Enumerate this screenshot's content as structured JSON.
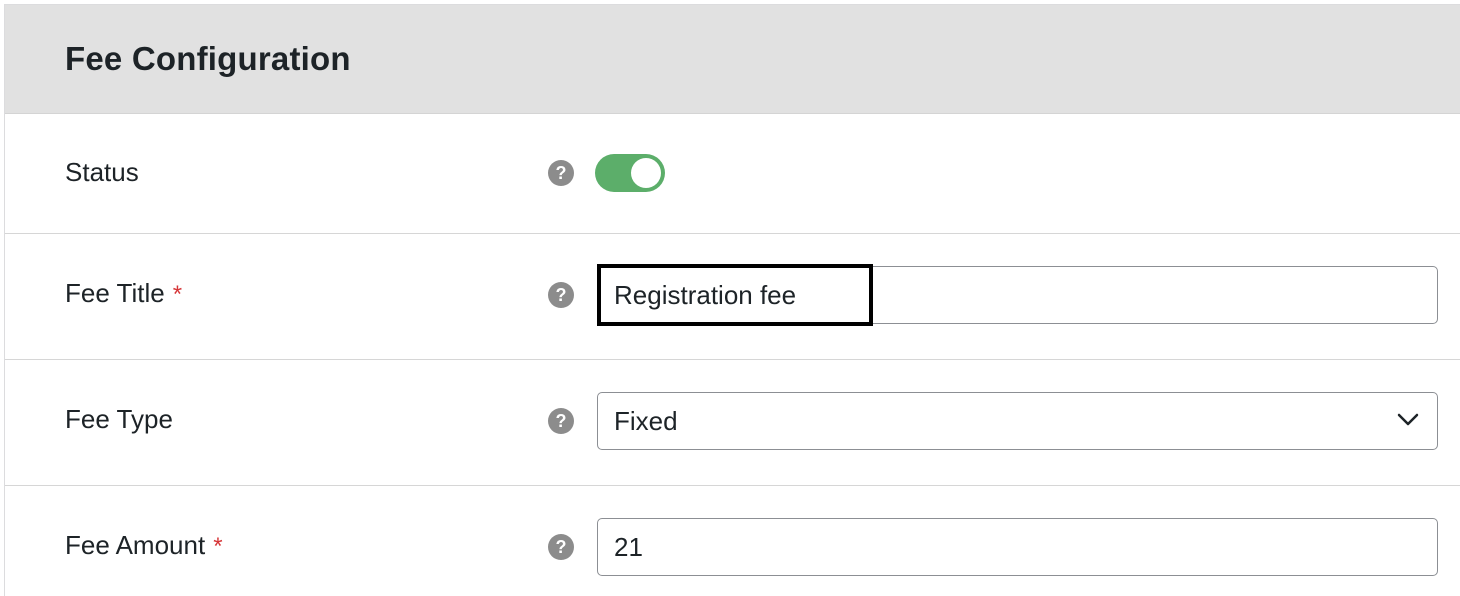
{
  "panel": {
    "title": "Fee Configuration"
  },
  "rows": {
    "status": {
      "label": "Status",
      "help_icon": "question-circle-icon",
      "toggle_on": true
    },
    "fee_title": {
      "label": "Fee Title",
      "required_mark": "*",
      "help_icon": "question-circle-icon",
      "value": "Registration fee"
    },
    "fee_type": {
      "label": "Fee Type",
      "help_icon": "question-circle-icon",
      "selected": "Fixed",
      "dropdown_icon": "chevron-down-icon"
    },
    "fee_amount": {
      "label": "Fee Amount",
      "required_mark": "*",
      "help_icon": "question-circle-icon",
      "value": "21"
    }
  },
  "help_glyph": "?",
  "colors": {
    "header_bg": "#e1e1e1",
    "toggle_on": "#5cae6a",
    "required": "#d63638",
    "help_icon": "#8c8c8c"
  }
}
